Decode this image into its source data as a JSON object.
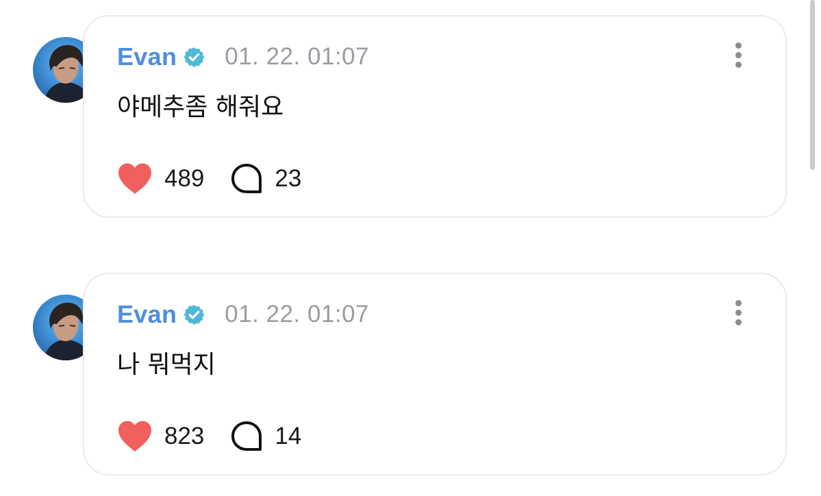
{
  "posts": [
    {
      "author": "Evan",
      "timestamp": "01. 22. 01:07",
      "text": "야메추좀 해줘요",
      "likes": "489",
      "comments": "23"
    },
    {
      "author": "Evan",
      "timestamp": "01. 22. 01:07",
      "text": "나 뭐먹지",
      "likes": "823",
      "comments": "14"
    }
  ],
  "icons": {
    "verified": "verified-badge-icon",
    "more": "more-vertical-icon",
    "like": "heart-icon",
    "comment": "comment-bubble-icon"
  },
  "colors": {
    "author_name": "#4f8fd9",
    "verified_badge": "#4fb8d8",
    "heart": "#f0605e",
    "timestamp": "#9b9ba3",
    "card_border": "#ebebef"
  }
}
